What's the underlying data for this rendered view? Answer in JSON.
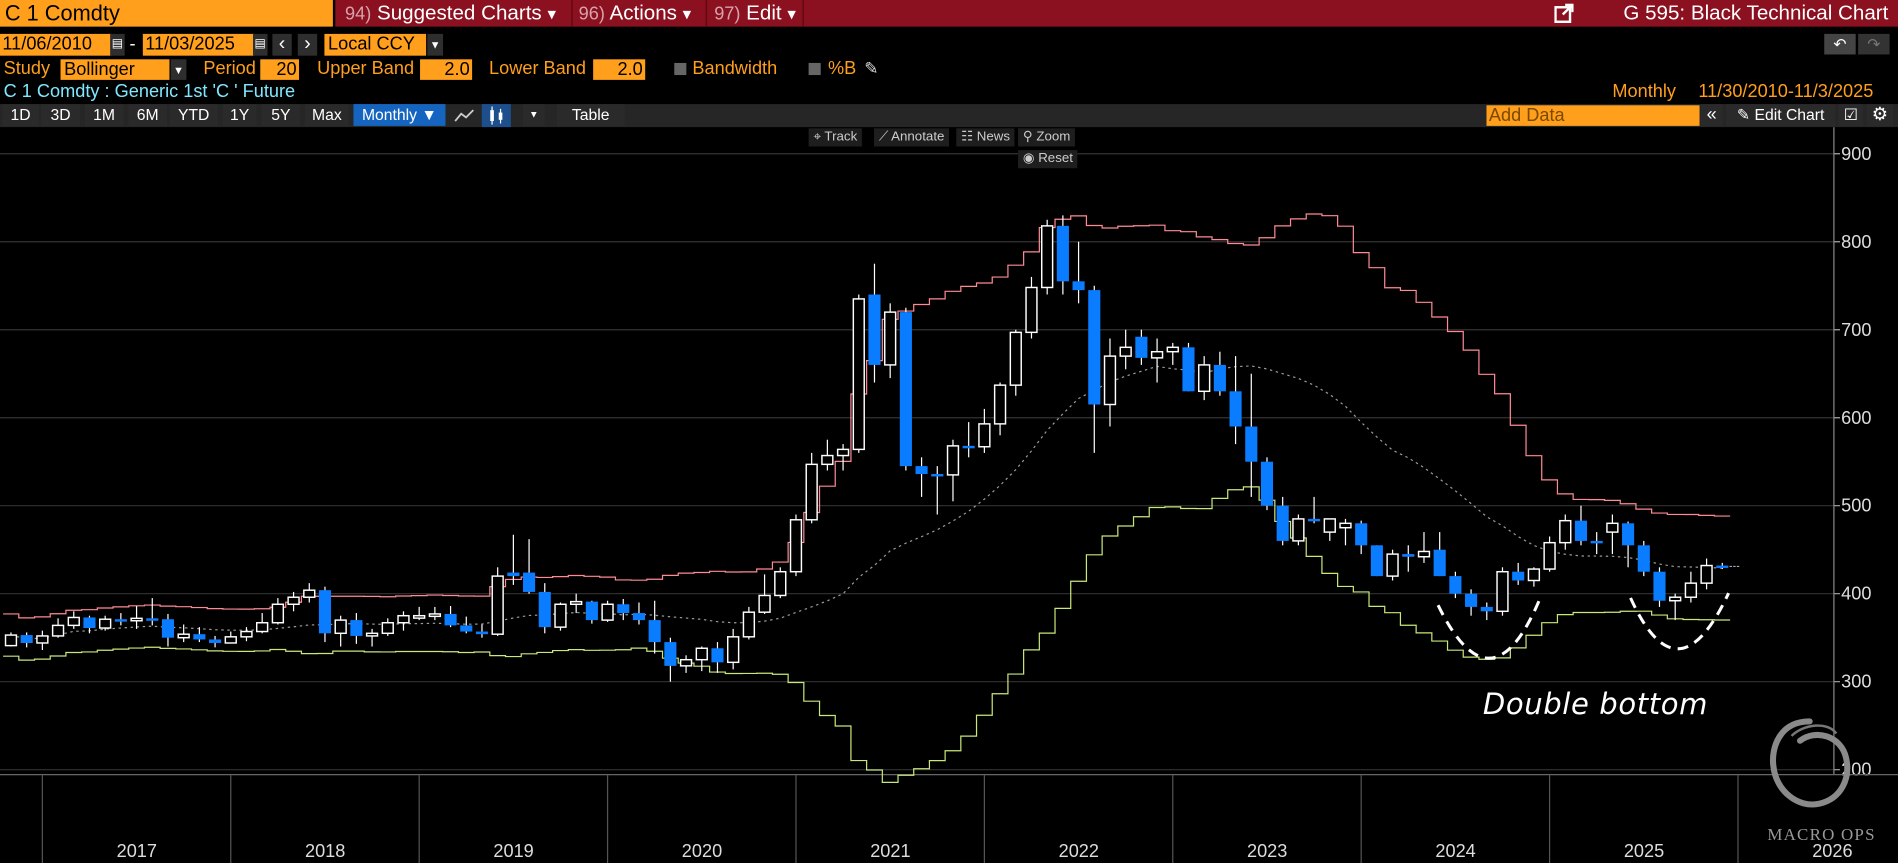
{
  "header": {
    "ticker": "C 1 Comdty",
    "menus": [
      {
        "num": "94)",
        "label": "Suggested Charts",
        "caret": "▾"
      },
      {
        "num": "96)",
        "label": "Actions",
        "caret": "▾"
      },
      {
        "num": "97)",
        "label": "Edit",
        "caret": "▾"
      }
    ],
    "title": "G 595: Black Technical Chart"
  },
  "dates": {
    "start": "11/06/2010",
    "sep": "-",
    "end": "11/03/2025",
    "currency": "Local CCY",
    "prev": "‹",
    "next": "›"
  },
  "study": {
    "label": "Study",
    "value": "Bollinger",
    "period_label": "Period",
    "period": "20",
    "upper_label": "Upper Band",
    "upper": "2.0",
    "lower_label": "Lower Band",
    "lower": "2.0",
    "bandwidth_label": "Bandwidth",
    "pctb_label": "%B"
  },
  "security": {
    "description": "C 1 Comdty : Generic 1st 'C ' Future",
    "frequency": "Monthly",
    "range": "11/30/2010-11/3/2025"
  },
  "toolbar": {
    "periods": [
      "1D",
      "3D",
      "1M",
      "6M",
      "YTD",
      "1Y",
      "5Y",
      "Max"
    ],
    "frequency": "Monthly ▼",
    "table": "Table",
    "add_data_placeholder": "Add Data",
    "collapse": "«",
    "edit_chart": "Edit Chart"
  },
  "chart_tools": {
    "track": "Track",
    "annotate": "Annotate",
    "news": "News",
    "zoom": "Zoom",
    "reset": "Reset"
  },
  "annotation": {
    "text": "Double bottom"
  },
  "logo": {
    "text": "MACRO OPS"
  },
  "colors": {
    "up": "#ffffff",
    "down": "#0a7cff",
    "upper_band": "#ff8a94",
    "lower_band": "#c8e87a",
    "middle_band": "#9a9a9a",
    "header": "#8b1020",
    "accent": "#ff9f1c"
  },
  "chart_data": {
    "type": "candlestick",
    "study": "Bollinger (20, 2.0, 2.0)",
    "ylim": [
      160,
      920
    ],
    "yticks": [
      200,
      300,
      400,
      500,
      600,
      700,
      800,
      900
    ],
    "xticks": [
      "2017",
      "2018",
      "2019",
      "2020",
      "2021",
      "2022",
      "2023",
      "2024",
      "2025",
      "2026"
    ],
    "grid": true,
    "candles": [
      [
        "2016-10",
        341,
        356,
        340,
        353
      ],
      [
        "2016-11",
        353,
        356,
        339,
        344
      ],
      [
        "2016-12",
        344,
        358,
        336,
        352
      ],
      [
        "2017-01",
        352,
        372,
        350,
        364
      ],
      [
        "2017-02",
        364,
        380,
        360,
        373
      ],
      [
        "2017-03",
        373,
        375,
        355,
        361
      ],
      [
        "2017-04",
        361,
        375,
        358,
        371
      ],
      [
        "2017-05",
        371,
        378,
        364,
        370
      ],
      [
        "2017-06",
        370,
        386,
        360,
        372
      ],
      [
        "2017-07",
        372,
        395,
        364,
        371
      ],
      [
        "2017-08",
        371,
        377,
        340,
        350
      ],
      [
        "2017-09",
        350,
        365,
        345,
        354
      ],
      [
        "2017-10",
        354,
        362,
        345,
        348
      ],
      [
        "2017-11",
        348,
        352,
        339,
        344
      ],
      [
        "2017-12",
        344,
        357,
        344,
        351
      ],
      [
        "2018-01",
        351,
        362,
        346,
        357
      ],
      [
        "2018-02",
        357,
        378,
        355,
        367
      ],
      [
        "2018-03",
        367,
        395,
        365,
        388
      ],
      [
        "2018-04",
        388,
        402,
        380,
        396
      ],
      [
        "2018-05",
        396,
        412,
        390,
        404
      ],
      [
        "2018-06",
        404,
        408,
        345,
        355
      ],
      [
        "2018-07",
        355,
        375,
        340,
        370
      ],
      [
        "2018-08",
        370,
        378,
        343,
        352
      ],
      [
        "2018-09",
        352,
        360,
        340,
        355
      ],
      [
        "2018-10",
        355,
        372,
        352,
        367
      ],
      [
        "2018-11",
        367,
        380,
        358,
        375
      ],
      [
        "2018-12",
        375,
        385,
        370,
        375
      ],
      [
        "2019-01",
        375,
        385,
        370,
        377
      ],
      [
        "2019-02",
        377,
        386,
        362,
        364
      ],
      [
        "2019-03",
        364,
        374,
        355,
        357
      ],
      [
        "2019-04",
        357,
        365,
        350,
        354
      ],
      [
        "2019-05",
        354,
        430,
        352,
        420
      ],
      [
        "2019-06",
        424,
        467,
        410,
        420
      ],
      [
        "2019-07",
        424,
        462,
        400,
        402
      ],
      [
        "2019-08",
        402,
        412,
        355,
        362
      ],
      [
        "2019-09",
        362,
        390,
        358,
        388
      ],
      [
        "2019-10",
        388,
        400,
        378,
        391
      ],
      [
        "2019-11",
        391,
        392,
        366,
        370
      ],
      [
        "2019-12",
        370,
        392,
        368,
        388
      ],
      [
        "2020-01",
        388,
        394,
        370,
        378
      ],
      [
        "2020-02",
        378,
        390,
        365,
        370
      ],
      [
        "2020-03",
        370,
        392,
        332,
        345
      ],
      [
        "2020-04",
        345,
        350,
        300,
        318
      ],
      [
        "2020-05",
        318,
        330,
        310,
        325
      ],
      [
        "2020-06",
        325,
        340,
        312,
        338
      ],
      [
        "2020-07",
        338,
        345,
        310,
        322
      ],
      [
        "2020-08",
        322,
        360,
        314,
        351
      ],
      [
        "2020-09",
        351,
        385,
        348,
        379
      ],
      [
        "2020-10",
        379,
        422,
        377,
        398
      ],
      [
        "2020-11",
        398,
        430,
        395,
        425
      ],
      [
        "2020-12",
        425,
        490,
        420,
        484
      ],
      [
        "2021-01",
        484,
        560,
        480,
        547
      ],
      [
        "2021-02",
        547,
        575,
        540,
        557
      ],
      [
        "2021-03",
        557,
        570,
        540,
        564
      ],
      [
        "2021-04",
        564,
        740,
        560,
        735
      ],
      [
        "2021-05",
        740,
        775,
        640,
        660
      ],
      [
        "2021-06",
        660,
        730,
        645,
        720
      ],
      [
        "2021-07",
        720,
        725,
        540,
        545
      ],
      [
        "2021-08",
        545,
        555,
        510,
        536
      ],
      [
        "2021-09",
        536,
        545,
        490,
        535
      ],
      [
        "2021-10",
        535,
        575,
        505,
        568
      ],
      [
        "2021-11",
        568,
        595,
        555,
        567
      ],
      [
        "2021-12",
        567,
        610,
        560,
        593
      ],
      [
        "2022-01",
        593,
        640,
        580,
        637
      ],
      [
        "2022-02",
        637,
        700,
        625,
        697
      ],
      [
        "2022-03",
        697,
        760,
        690,
        748
      ],
      [
        "2022-04",
        748,
        825,
        740,
        818
      ],
      [
        "2022-05",
        818,
        830,
        740,
        755
      ],
      [
        "2022-06",
        755,
        800,
        730,
        745
      ],
      [
        "2022-07",
        745,
        750,
        560,
        615
      ],
      [
        "2022-08",
        615,
        690,
        590,
        670
      ],
      [
        "2022-09",
        670,
        700,
        655,
        680
      ],
      [
        "2022-10",
        692,
        700,
        660,
        668
      ],
      [
        "2022-11",
        668,
        690,
        640,
        675
      ],
      [
        "2022-12",
        675,
        685,
        660,
        680
      ],
      [
        "2023-01",
        680,
        685,
        630,
        630
      ],
      [
        "2023-02",
        630,
        670,
        620,
        660
      ],
      [
        "2023-03",
        660,
        675,
        625,
        630
      ],
      [
        "2023-04",
        630,
        670,
        570,
        590
      ],
      [
        "2023-05",
        590,
        650,
        510,
        550
      ],
      [
        "2023-06",
        550,
        555,
        495,
        500
      ],
      [
        "2023-07",
        500,
        510,
        455,
        460
      ],
      [
        "2023-08",
        460,
        490,
        455,
        485
      ],
      [
        "2023-09",
        485,
        510,
        480,
        483
      ],
      [
        "2023-10",
        470,
        485,
        460,
        485
      ],
      [
        "2023-11",
        475,
        485,
        455,
        480
      ],
      [
        "2023-12",
        480,
        483,
        445,
        455
      ],
      [
        "2024-01",
        455,
        455,
        420,
        420
      ],
      [
        "2024-02",
        420,
        450,
        415,
        445
      ],
      [
        "2024-03",
        445,
        455,
        425,
        442
      ],
      [
        "2024-04",
        442,
        470,
        435,
        448
      ],
      [
        "2024-05",
        450,
        470,
        420,
        420
      ],
      [
        "2024-06",
        420,
        425,
        395,
        400
      ],
      [
        "2024-07",
        400,
        405,
        375,
        385
      ],
      [
        "2024-08",
        385,
        390,
        370,
        380
      ],
      [
        "2024-09",
        380,
        430,
        375,
        425
      ],
      [
        "2024-10",
        425,
        435,
        410,
        415
      ],
      [
        "2024-11",
        415,
        430,
        408,
        428
      ],
      [
        "2024-12",
        428,
        465,
        425,
        458
      ],
      [
        "2025-01",
        458,
        490,
        450,
        483
      ],
      [
        "2025-02",
        483,
        500,
        455,
        460
      ],
      [
        "2025-03",
        460,
        470,
        445,
        458
      ],
      [
        "2025-04",
        470,
        490,
        445,
        480
      ],
      [
        "2025-05",
        480,
        482,
        430,
        455
      ],
      [
        "2025-06",
        455,
        460,
        420,
        425
      ],
      [
        "2025-07",
        425,
        430,
        385,
        392
      ],
      [
        "2025-08",
        392,
        400,
        370,
        396
      ],
      [
        "2025-09",
        396,
        425,
        390,
        412
      ],
      [
        "2025-10",
        412,
        440,
        405,
        432
      ],
      [
        "2025-11",
        432,
        435,
        428,
        431
      ]
    ]
  }
}
